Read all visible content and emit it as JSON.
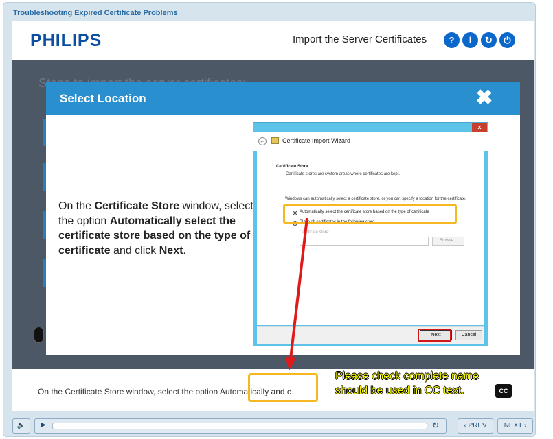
{
  "course_title": "Troubleshooting Expired Certificate Problems",
  "header": {
    "logo": "PHILIPS",
    "title": "Import the Server Certificates",
    "buttons": {
      "help": "?",
      "info": "i",
      "replay": "↻",
      "exit": "⏻"
    }
  },
  "background": {
    "steps_title": "Steps to import the server certificates:"
  },
  "modal": {
    "title": "Select Location",
    "close": "✖",
    "instruction": {
      "p1": "On the ",
      "b1": "Certificate Store",
      "p2": " window, select the option ",
      "b2": "Automatically select the certificate store based on the type of certificate",
      "p3": " and click ",
      "b3": "Next",
      "p4": "."
    }
  },
  "wizard": {
    "close": "x",
    "title": "Certificate Import Wizard",
    "heading": "Certificate Store",
    "subheading": "Certificate stores are system areas where certificates are kept.",
    "intro": "Windows can automatically select a certificate store, or you can specify a location for the certificate.",
    "option_auto": "Automatically select the certificate store based on the type of certificate",
    "option_place": "Place all certificates in the following store",
    "store_label": "Certificate store:",
    "browse": "Browse...",
    "next": "Next",
    "cancel": "Cancel"
  },
  "caption": {
    "text_before": "On the Certificate Store window, select the option ",
    "highlighted": "Automatically",
    "text_after": " and c"
  },
  "annotation": {
    "line1": "Please check complete name",
    "line2": "should be used in CC text."
  },
  "cc_button": "CC",
  "controls": {
    "prev": "PREV",
    "next": "NEXT"
  },
  "colors": {
    "accent_blue": "#2a8fce",
    "highlight": "#f5b820",
    "arrow_red": "#e01a1a",
    "annotation_text": "#f2f200"
  }
}
